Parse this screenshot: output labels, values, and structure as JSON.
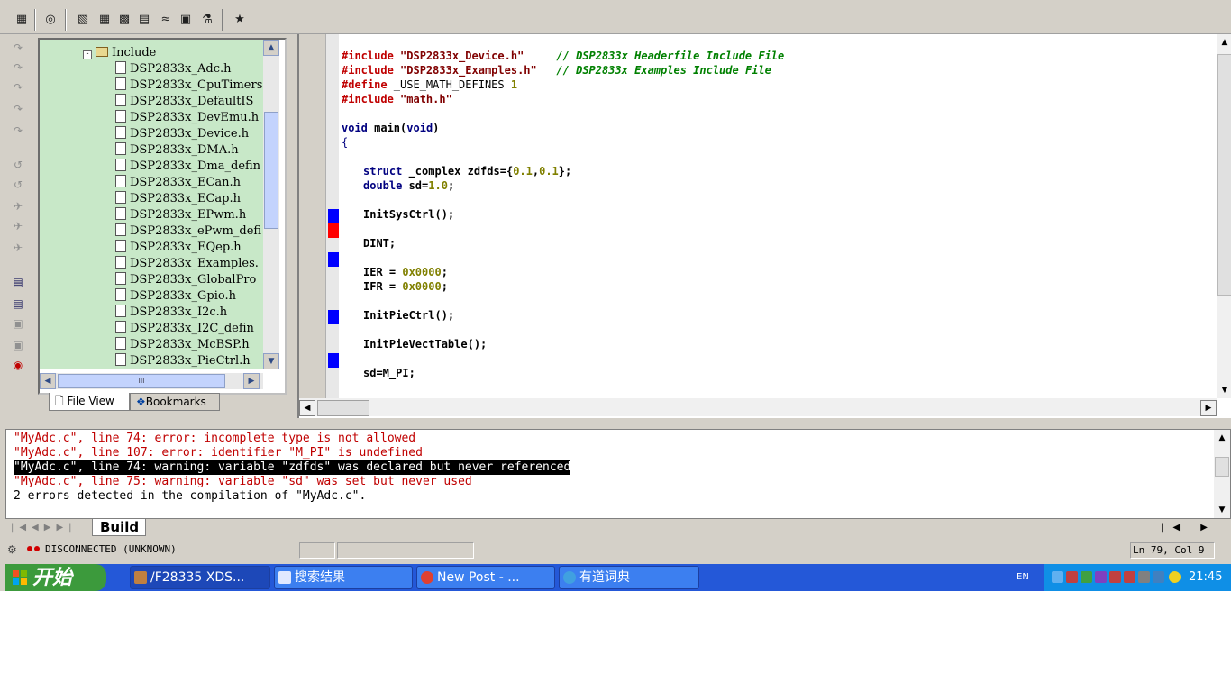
{
  "toolbar": {
    "icons": [
      "project-icon",
      "find-icon",
      "clipboard-icon",
      "calculator-icon",
      "window-icon",
      "graph-icon",
      "image-icon",
      "probe-icon",
      "help-icon"
    ]
  },
  "tree": {
    "folder": "Include",
    "files": [
      "DSP2833x_Adc.h",
      "DSP2833x_CpuTimers",
      "DSP2833x_DefaultIS",
      "DSP2833x_DevEmu.h",
      "DSP2833x_Device.h",
      "DSP2833x_DMA.h",
      "DSP2833x_Dma_defin",
      "DSP2833x_ECan.h",
      "DSP2833x_ECap.h",
      "DSP2833x_EPwm.h",
      "DSP2833x_ePwm_defi",
      "DSP2833x_EQep.h",
      "DSP2833x_Examples.",
      "DSP2833x_GlobalPro",
      "DSP2833x_Gpio.h",
      "DSP2833x_I2c.h",
      "DSP2833x_I2C_defin",
      "DSP2833x_McBSP.h",
      "DSP2833x_PieCtrl.h"
    ],
    "tabs": {
      "file_view": "File View",
      "bookmarks": "Bookmarks"
    },
    "hscroll_thumb_label": "III"
  },
  "editor": {
    "lines": {
      "l1": {
        "pp": "#include",
        "str": " \"DSP2833x_Device.h\"",
        "cmt": "     // DSP2833x Headerfile Include File"
      },
      "l2": {
        "pp": "#include",
        "str": " \"DSP2833x_Examples.h\"",
        "cmt": "   // DSP2833x Examples Include File"
      },
      "l3": {
        "pp": "#define",
        "txt": " _USE_MATH_DEFINES ",
        "num": "1"
      },
      "l4": {
        "pp": "#include",
        "str": " \"math.h\""
      },
      "l5": {
        "kw1": "void",
        "fn": " main(",
        "kw2": "void",
        "end": ")"
      },
      "l6": "{",
      "l7": {
        "kw": "struct",
        "txt": " _complex zdfds={",
        "n1": "0.1",
        "comma": ",",
        "n2": "0.1",
        "end": "};"
      },
      "l8": {
        "kw": "double",
        "txt": " sd=",
        "n1": "1.0",
        "end": ";"
      },
      "l9": "InitSysCtrl();",
      "l10": "DINT;",
      "l11": {
        "txt": "IER = ",
        "num": "0x0000",
        "end": ";"
      },
      "l12": {
        "txt": "IFR = ",
        "num": "0x0000",
        "end": ";"
      },
      "l13": "InitPieCtrl();",
      "l14": "InitPieVectTable();",
      "l15": "sd=M_PI;"
    },
    "marker_colors": {
      "breakpoint": "#0000ff",
      "current": "#ff0000"
    }
  },
  "output": {
    "lines": [
      "\"MyAdc.c\", line 74: error: incomplete type is not allowed",
      "\"MyAdc.c\", line 107: error: identifier \"M_PI\" is undefined",
      "\"MyAdc.c\", line 74: warning: variable \"zdfds\" was declared but never referenced",
      "\"MyAdc.c\", line 75: warning: variable \"sd\" was set but never used",
      "2 errors detected in the compilation of \"MyAdc.c\"."
    ],
    "tab": "Build"
  },
  "status": {
    "connection": "DISCONNECTED (UNKNOWN)",
    "position": "Ln 79, Col 9"
  },
  "taskbar": {
    "start": "开始",
    "items": [
      "/F28335 XDS...",
      "搜索结果",
      "New Post - ...",
      "有道词典"
    ],
    "lang": "EN",
    "clock": "21:45"
  }
}
